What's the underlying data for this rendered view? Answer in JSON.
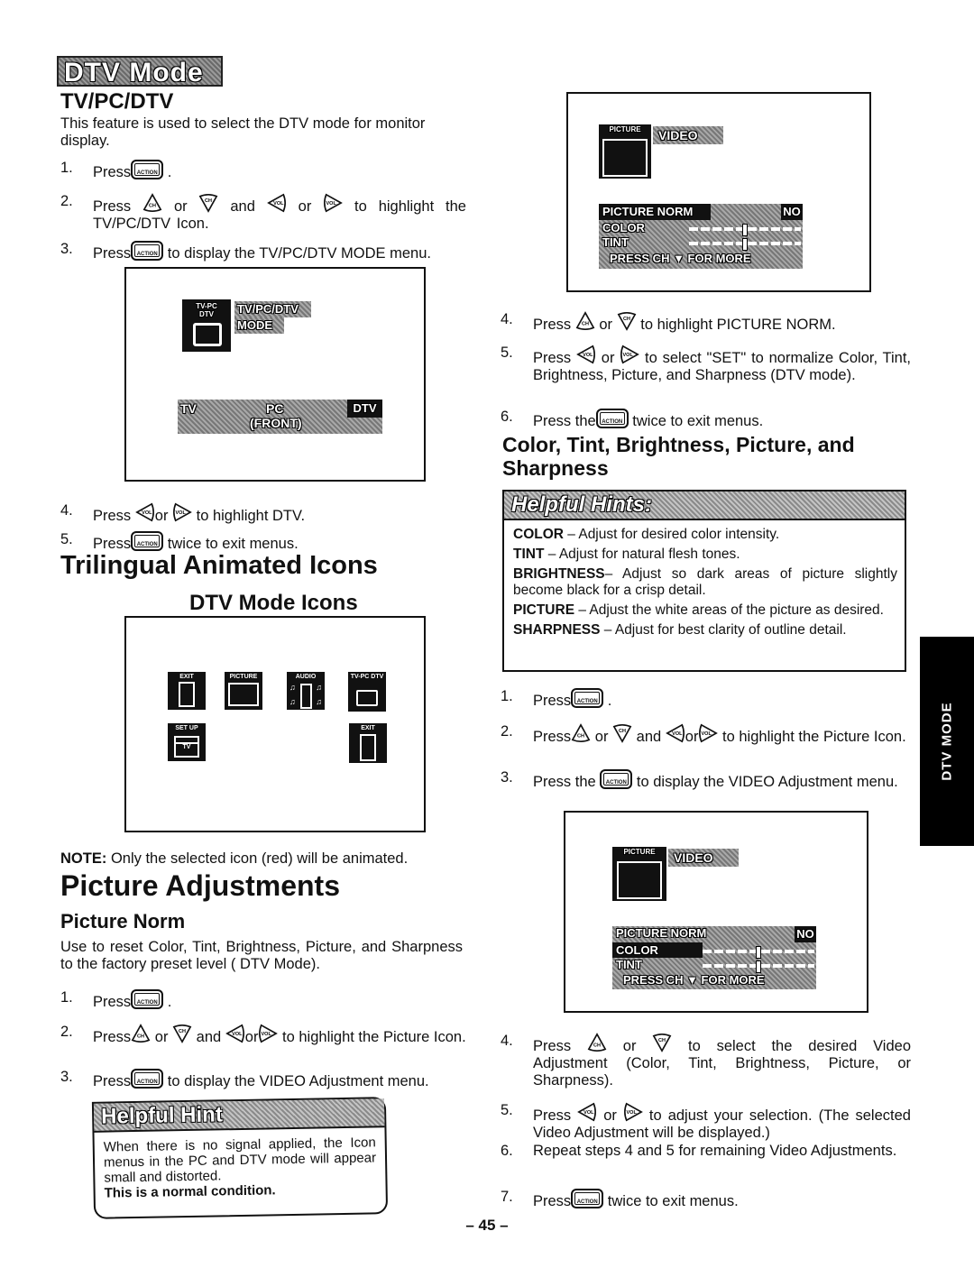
{
  "page": {
    "title_badge": "DTV Mode",
    "page_number": "– 45 –",
    "side_tab": "DTV MODE"
  },
  "tvpcdtv": {
    "heading": "TV/PC/DTV",
    "intro": "This feature is used to select the DTV mode for monitor display.",
    "steps": [
      {
        "num": "1.",
        "before": "Press",
        "icons": [
          "action-button"
        ],
        "after": "."
      },
      {
        "num": "2.",
        "text": "Press [CH▲] or [CH▼] and [VOL◄] or [VOL►] to highlight the TV/PC/DTV Icon."
      },
      {
        "num": "3.",
        "before": "Press",
        "after": "to display the TV/PC/DTV MODE menu."
      },
      {
        "num": "4.",
        "text": "Press [VOL◄] or [VOL►] to highlight DTV."
      },
      {
        "num": "5.",
        "before": "Press",
        "after": "twice to exit menus."
      }
    ],
    "screen": {
      "icon_label_line1": "TV-PC",
      "icon_label_line2": "DTV",
      "menu_title_line1": "TV/PC/DTV",
      "menu_title_line2": "MODE",
      "options": [
        "TV",
        "PC",
        "(FRONT)",
        "DTV"
      ],
      "selected": "DTV"
    }
  },
  "trilingual": {
    "heading": "Trilingual Animated Icons",
    "subheading": "DTV Mode Icons",
    "icons": [
      "EXIT",
      "PICTURE",
      "AUDIO",
      "TV-PC DTV",
      "SET UP",
      "EXIT"
    ],
    "setup_inner": "TV",
    "note_label": "NOTE:",
    "note_text": "Only the selected icon (red) will be animated."
  },
  "picture_adjustments": {
    "heading": "Picture Adjustments",
    "subheading": "Picture Norm",
    "intro": "Use to reset Color, Tint, Brightness, Picture, and Sharpness to the factory preset level ( DTV Mode).",
    "steps_left": [
      {
        "num": "1.",
        "before": "Press",
        "after": "."
      },
      {
        "num": "2.",
        "before": "Press",
        "after": "to highlight the Picture Icon."
      },
      {
        "num": "3.",
        "before": "Press",
        "after": "to display the VIDEO Adjustment menu."
      }
    ],
    "hint": {
      "title": "Helpful Hint",
      "text": "When there is no signal applied, the Icon menus in the PC and DTV mode will appear small and distorted.",
      "bold_text": "This is a normal condition."
    },
    "steps_right": [
      {
        "num": "4.",
        "before": "Press",
        "after": "to highlight PICTURE NORM."
      },
      {
        "num": "5.",
        "before": "Press",
        "after": "to select \"SET\" to normalize Color, Tint, Brightness, Picture, and Sharpness (DTV mode)."
      },
      {
        "num": "6.",
        "before": "Press the",
        "after": "twice to exit menus."
      }
    ],
    "osd": {
      "icon_label": "PICTURE",
      "menu_title": "VIDEO",
      "rows": [
        "PICTURE NORM",
        "COLOR",
        "TINT"
      ],
      "norm_value": "NO",
      "footer": "PRESS CH ▼ FOR MORE",
      "color_level": 0.5,
      "tint_level": 0.5
    }
  },
  "ctbps": {
    "heading": "Color, Tint, Brightness, Picture, and Sharpness",
    "hints_title": "Helpful Hints:",
    "hints": [
      {
        "term": "COLOR",
        "desc": "– Adjust for desired color intensity."
      },
      {
        "term": "TINT",
        "desc": "– Adjust for natural flesh tones."
      },
      {
        "term": "BRIGHTNESS",
        "desc": "– Adjust so dark areas of picture slightly become black for a crisp detail."
      },
      {
        "term": "PICTURE",
        "desc": "– Adjust the white areas of the picture as desired."
      },
      {
        "term": "SHARPNESS",
        "desc": "– Adjust for best clarity of outline detail."
      }
    ],
    "steps_a": [
      {
        "num": "1.",
        "before": "Press",
        "after": "."
      },
      {
        "num": "2.",
        "before": "Press",
        "after": "to highlight the Picture Icon."
      },
      {
        "num": "3.",
        "before": "Press the",
        "after": "to display the VIDEO Adjustment menu."
      }
    ],
    "steps_b": [
      {
        "num": "4.",
        "before": "Press",
        "after": "to select the desired Video Adjustment (Color, Tint, Brightness, Picture, or Sharpness)."
      },
      {
        "num": "5.",
        "before": "Press",
        "after": "to adjust your selection.  (The selected Video Adjustment will be displayed.)"
      },
      {
        "num": "6.",
        "text": "Repeat steps 4 and 5 for remaining Video Adjustments."
      },
      {
        "num": "7.",
        "before": "Press",
        "after": "twice to exit menus."
      }
    ],
    "or": "or",
    "and": "and"
  }
}
